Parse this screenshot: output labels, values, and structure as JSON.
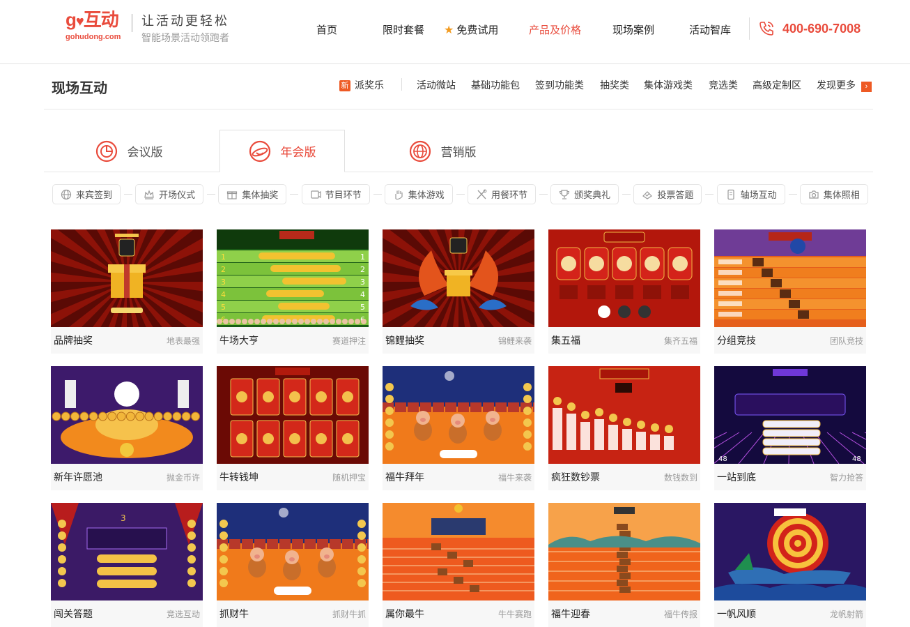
{
  "brand": {
    "logo_text": "go互动",
    "logo_sub": "gohudong.com",
    "slogan": "让活动更轻松",
    "slogan_sub": "智能场景活动领跑者"
  },
  "nav": {
    "items": [
      "首页",
      "限时套餐",
      "免费试用",
      "产品及价格",
      "现场案例",
      "活动智库"
    ],
    "active": "产品及价格",
    "phone": "400-690-7008"
  },
  "section": {
    "title": "现场互动",
    "badge": "新",
    "featured": "派奖乐",
    "links": [
      "活动微站",
      "基础功能包",
      "签到功能类",
      "抽奖类",
      "集体游戏类",
      "竞选类",
      "高级定制区"
    ],
    "more": "发现更多"
  },
  "tabs": [
    {
      "label": "会议版",
      "icon": "pie-chart-icon"
    },
    {
      "label": "年会版",
      "icon": "smiley-planet-icon",
      "active": true
    },
    {
      "label": "营销版",
      "icon": "globe-icon"
    }
  ],
  "categories": [
    {
      "label": "来宾签到",
      "icon": "globe-icon"
    },
    {
      "label": "开场仪式",
      "icon": "crown-icon"
    },
    {
      "label": "集体抽奖",
      "icon": "gift-icon"
    },
    {
      "label": "节目环节",
      "icon": "video-icon"
    },
    {
      "label": "集体游戏",
      "icon": "hand-icon"
    },
    {
      "label": "用餐环节",
      "icon": "utensils-icon"
    },
    {
      "label": "颁奖典礼",
      "icon": "trophy-icon"
    },
    {
      "label": "投票答题",
      "icon": "vote-icon"
    },
    {
      "label": "轴场互动",
      "icon": "phone-icon"
    },
    {
      "label": "集体照相",
      "icon": "camera-icon"
    }
  ],
  "cards": [
    {
      "title": "品牌抽奖",
      "tag": "地表最强",
      "theme": "gift-red"
    },
    {
      "title": "牛场大亨",
      "tag": "赛道押注",
      "theme": "race-green"
    },
    {
      "title": "锦鲤抽奖",
      "tag": "锦鲤来袭",
      "theme": "koi-red"
    },
    {
      "title": "集五福",
      "tag": "集齐五福",
      "theme": "fu-red"
    },
    {
      "title": "分组竞技",
      "tag": "团队竞技",
      "theme": "ox-orange"
    },
    {
      "title": "新年许愿池",
      "tag": "抛金币许",
      "theme": "wish-purple"
    },
    {
      "title": "牛转钱坤",
      "tag": "随机押宝",
      "theme": "cards-red"
    },
    {
      "title": "福牛拜年",
      "tag": "福牛来袭",
      "theme": "dance-night"
    },
    {
      "title": "疯狂数钞票",
      "tag": "数钱数到",
      "theme": "bars-red"
    },
    {
      "title": "一站到底",
      "tag": "智力抢答",
      "theme": "quiz-blue"
    },
    {
      "title": "闯关答题",
      "tag": "竞选互动",
      "theme": "quiz-purple"
    },
    {
      "title": "抓财牛",
      "tag": "抓财牛抓",
      "theme": "dance-night"
    },
    {
      "title": "属你最牛",
      "tag": "牛牛赛跑",
      "theme": "run-orange"
    },
    {
      "title": "福牛迎春",
      "tag": "福牛传报",
      "theme": "stack-orange"
    },
    {
      "title": "一帆风顺",
      "tag": "龙帆射箭",
      "theme": "boat-purple"
    }
  ]
}
